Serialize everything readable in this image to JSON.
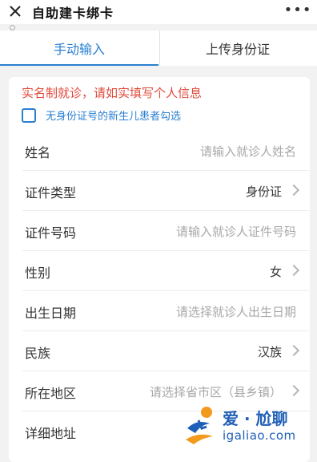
{
  "header": {
    "title": "自助建卡绑卡",
    "close_icon": "close-icon",
    "more_label": "•••"
  },
  "tabs": [
    {
      "label": "手动输入",
      "active": true
    },
    {
      "label": "上传身份证",
      "active": false
    }
  ],
  "form": {
    "notice": "实名制就诊，请如实填写个人信息",
    "newborn_label": "无身份证号的新生儿患者勾选",
    "newborn_checked": false,
    "fields": [
      {
        "label": "姓名",
        "placeholder": "请输入就诊人姓名",
        "value": "",
        "chevron": false
      },
      {
        "label": "证件类型",
        "placeholder": "",
        "value": "身份证",
        "chevron": true
      },
      {
        "label": "证件号码",
        "placeholder": "请输入就诊人证件号码",
        "value": "",
        "chevron": false
      },
      {
        "label": "性别",
        "placeholder": "",
        "value": "女",
        "chevron": true
      },
      {
        "label": "出生日期",
        "placeholder": "请选择就诊人出生日期",
        "value": "",
        "chevron": false
      },
      {
        "label": "民族",
        "placeholder": "",
        "value": "汉族",
        "chevron": true
      },
      {
        "label": "所在地区",
        "placeholder": "请选择省市区（县乡镇）",
        "value": "",
        "chevron": true
      },
      {
        "label": "详细地址",
        "placeholder": "",
        "value": "",
        "chevron": false
      }
    ]
  },
  "watermark": {
    "text": "爱 · 尬聊",
    "url": "igaliao.com"
  },
  "colors": {
    "accent": "#2b7fd1",
    "notice_red": "#e04a3a",
    "watermark_blue": "#1f5fb7",
    "watermark_orange": "#f29a1e"
  }
}
